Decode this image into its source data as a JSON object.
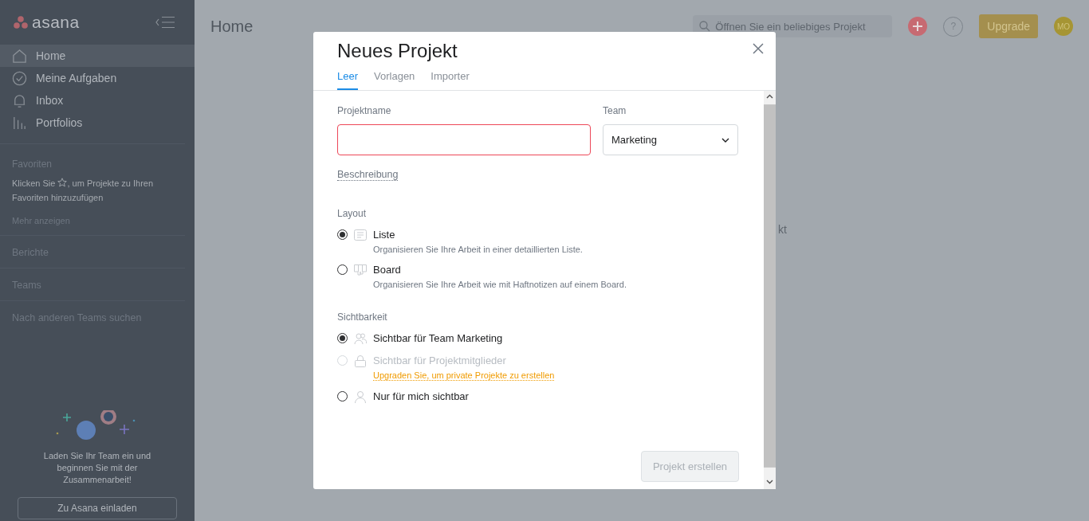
{
  "sidebar": {
    "logo": "asana",
    "nav": [
      {
        "label": "Home",
        "kind": "home",
        "selected": true
      },
      {
        "label": "Meine Aufgaben",
        "kind": "check",
        "selected": false
      },
      {
        "label": "Inbox",
        "kind": "bell",
        "selected": false
      },
      {
        "label": "Portfolios",
        "kind": "bars",
        "selected": false
      }
    ],
    "favorites": {
      "heading": "Favoriten",
      "hint_before": "Klicken Sie",
      "hint_after": ", um Projekte zu Ihren Favoriten hinzuzufügen",
      "more": "Mehr anzeigen"
    },
    "sections": [
      "Berichte",
      "Teams"
    ],
    "browse": "Nach anderen Teams suchen",
    "invite_text": "Laden Sie Ihr Team ein und beginnen Sie mit der Zusammenarbeit!",
    "invite_button": "Zu Asana einladen"
  },
  "header": {
    "title": "Home",
    "search_placeholder": "Öffnen Sie ein beliebiges Projekt",
    "help": "?",
    "upgrade": "Upgrade",
    "avatar": "MO"
  },
  "background_text": "kt",
  "dialog": {
    "title": "Neues Projekt",
    "tabs": [
      {
        "label": "Leer",
        "selected": true
      },
      {
        "label": "Vorlagen",
        "selected": false
      },
      {
        "label": "Importer",
        "selected": false
      }
    ],
    "name_label": "Projektname",
    "name_invalid": true,
    "team_label": "Team",
    "team_value": "Marketing",
    "description_link": "Beschreibung",
    "layout": {
      "heading": "Layout",
      "options": [
        {
          "label": "Liste",
          "kind": "list",
          "description": "Organisieren Sie Ihre Arbeit in einer detaillierten Liste.",
          "selected": true
        },
        {
          "label": "Board",
          "kind": "board",
          "description": "Organisieren Sie Ihre Arbeit wie mit Haftnotizen auf einem Board.",
          "selected": false
        }
      ]
    },
    "visibility": {
      "heading": "Sichtbarkeit",
      "options": [
        {
          "label": "Sichtbar für Team Marketing",
          "kind": "team",
          "selected": true,
          "disabled": false
        },
        {
          "label": "Sichtbar für Projektmitglieder",
          "kind": "lock",
          "selected": false,
          "disabled": true,
          "note": "Upgraden Sie, um private Projekte zu erstellen"
        },
        {
          "label": "Nur für mich sichtbar",
          "kind": "person",
          "selected": false,
          "disabled": false
        }
      ]
    },
    "submit": {
      "label": "Projekt erstellen",
      "disabled": true
    }
  }
}
